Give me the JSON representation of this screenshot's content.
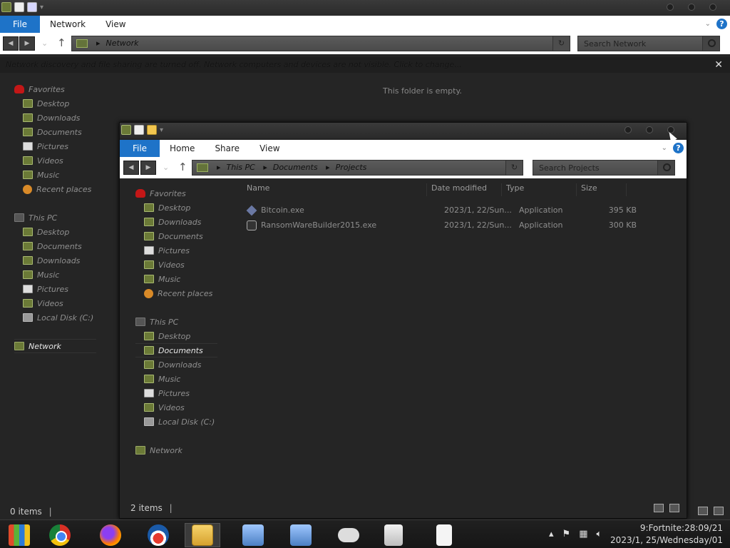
{
  "back_window": {
    "ribbon": {
      "file_tab": "File",
      "tabs": [
        "Network",
        "View"
      ]
    },
    "address": {
      "crumbs": [
        "Network"
      ]
    },
    "search_placeholder": "Search Network",
    "infobar": "Network discovery and file sharing are turned off. Network computers and devices are not visible. Click to change...",
    "empty_message": "This folder is empty.",
    "status": "0 items",
    "nav": {
      "favorites": "Favorites",
      "fav_items": [
        "Desktop",
        "Downloads",
        "Documents",
        "Pictures",
        "Videos",
        "Music",
        "Recent places"
      ],
      "this_pc": "This PC",
      "pc_items": [
        "Desktop",
        "Documents",
        "Downloads",
        "Music",
        "Pictures",
        "Videos",
        "Local Disk (C:)"
      ],
      "network": "Network"
    }
  },
  "front_window": {
    "ribbon": {
      "file_tab": "File",
      "tabs": [
        "Home",
        "Share",
        "View"
      ]
    },
    "address": {
      "crumbs": [
        "This PC",
        "Documents",
        "Projects"
      ]
    },
    "search_placeholder": "Search Projects",
    "columns": [
      "Name",
      "Date modified",
      "Type",
      "Size"
    ],
    "files": [
      {
        "name": "Bitcoin.exe",
        "date": "2023/1, 22/Sun...",
        "type": "Application",
        "size": "395 KB",
        "icon": "diamond-app-icon"
      },
      {
        "name": "RansomWareBuilder2015.exe",
        "date": "2023/1, 22/Sun...",
        "type": "Application",
        "size": "300 KB",
        "icon": "setup-app-icon"
      }
    ],
    "status": "2 items",
    "nav": {
      "favorites": "Favorites",
      "fav_items": [
        "Desktop",
        "Downloads",
        "Documents",
        "Pictures",
        "Videos",
        "Music",
        "Recent places"
      ],
      "this_pc": "This PC",
      "pc_items": [
        "Desktop",
        "Documents",
        "Downloads",
        "Music",
        "Pictures",
        "Videos",
        "Local Disk (C:)"
      ],
      "network": "Network"
    }
  },
  "taskbar": {
    "apps": [
      "windows-icon",
      "chrome-icon",
      "firefox-icon",
      "obama-logo-icon",
      "file-explorer-icon",
      "setup-icon",
      "setup-icon",
      "gamepad-icon",
      "recycle-bin-icon",
      "document-icon"
    ],
    "clock_line1": "9:Fortnite:28:09/21",
    "clock_line2": "2023/1, 25/Wednesday/01"
  }
}
